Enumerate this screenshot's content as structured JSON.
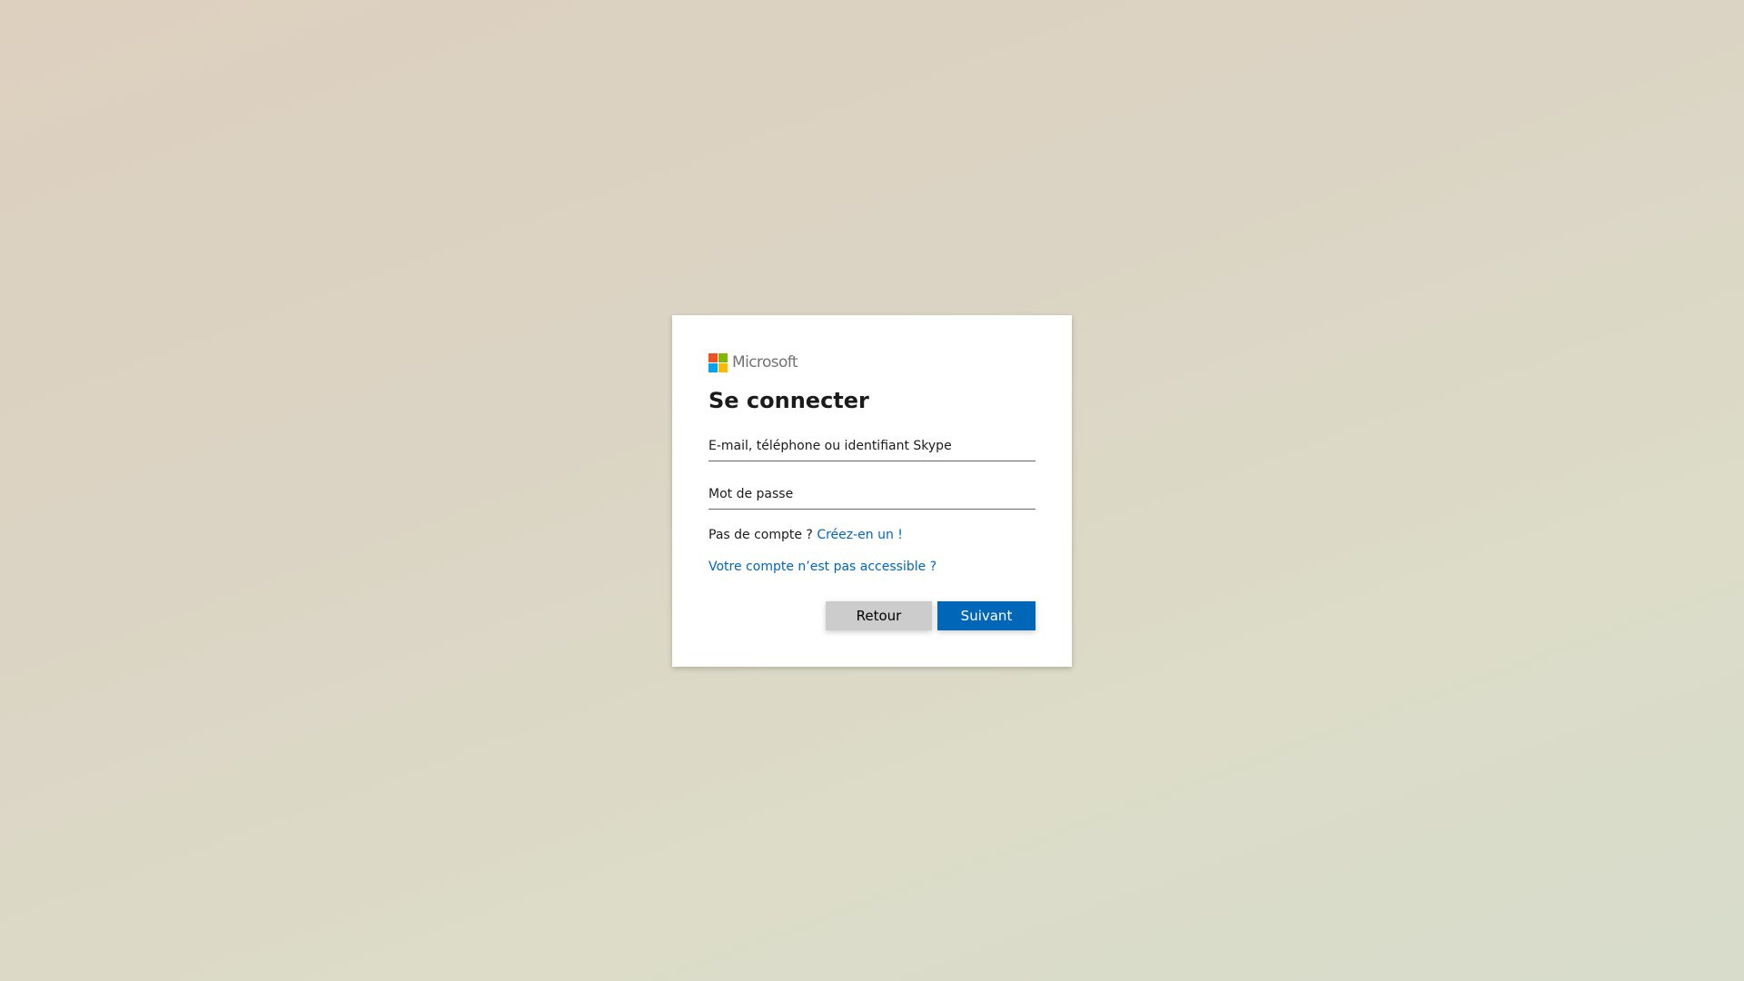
{
  "brand": {
    "name": "Microsoft",
    "icon": "microsoft-logo-icon"
  },
  "signin": {
    "title": "Se connecter",
    "email_placeholder": "E-mail, téléphone ou identifiant Skype",
    "email_value": "",
    "password_placeholder": "Mot de passe",
    "password_value": "",
    "no_account_text": "Pas de compte ?",
    "create_link": "Créez-en un !",
    "inaccessible_link": "Votre compte n’est pas accessible ?",
    "back_label": "Retour",
    "next_label": "Suivant"
  },
  "colors": {
    "accent": "#0067b8",
    "back_button": "#cccccc",
    "logo_red": "#f25022",
    "logo_green": "#7fba00",
    "logo_blue": "#00a4ef",
    "logo_yellow": "#ffb900"
  }
}
